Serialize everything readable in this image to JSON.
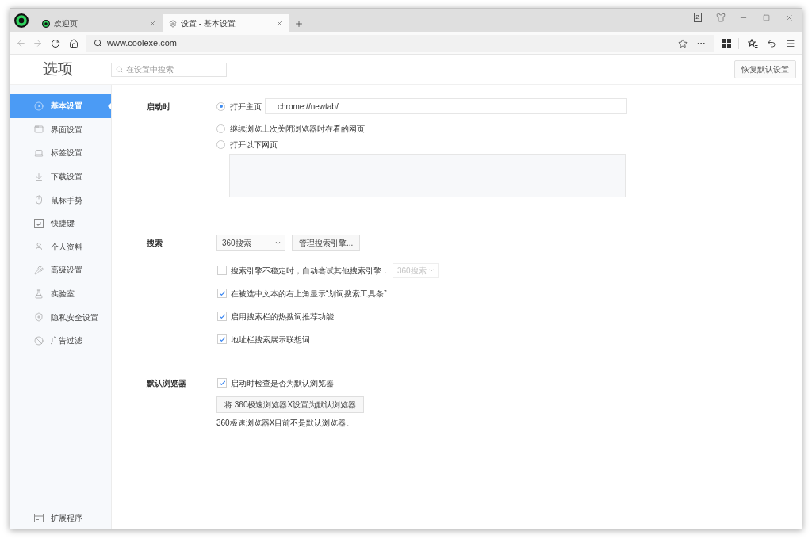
{
  "browser": {
    "tabs": [
      {
        "title": "欢迎页",
        "selected": false
      },
      {
        "title": "设置 - 基本设置",
        "selected": true
      }
    ],
    "tab_count": "2",
    "back": {
      "disabled": true
    },
    "forward": {
      "disabled": true
    },
    "address": "www.coolexe.com"
  },
  "header": {
    "title": "选项",
    "search": {
      "placeholder": "在设置中搜索"
    },
    "reset_button": "恢复默认设置"
  },
  "sidebar": {
    "items": [
      {
        "label": "基本设置",
        "selected": true
      },
      {
        "label": "界面设置",
        "selected": false
      },
      {
        "label": "标签设置",
        "selected": false
      },
      {
        "label": "下载设置",
        "selected": false
      },
      {
        "label": "鼠标手势",
        "selected": false
      },
      {
        "label": "快捷键",
        "selected": false
      },
      {
        "label": "个人资料",
        "selected": false
      },
      {
        "label": "高级设置",
        "selected": false
      },
      {
        "label": "实验室",
        "selected": false
      },
      {
        "label": "隐私安全设置",
        "selected": false
      },
      {
        "label": "广告过滤",
        "selected": false
      }
    ],
    "footer_item": "扩展程序"
  },
  "sections": [
    {
      "label": "启动时",
      "rows": [
        {
          "kind": "radio",
          "label": "打开主页",
          "selected": true,
          "field": {
            "value": "chrome://newtab/"
          }
        },
        {
          "kind": "radio",
          "label": "继续浏览上次关闭浏览器时在看的网页",
          "selected": false
        },
        {
          "kind": "radio_with_list",
          "label": "打开以下网页",
          "selected": false
        }
      ]
    },
    {
      "label": "搜索",
      "rows": [
        {
          "kind": "select",
          "value": "360搜索",
          "button": "管理搜索引擎..."
        },
        {
          "kind": "checkbox",
          "label": "搜索引擎不稳定时，自动尝试其他搜索引擎：",
          "checked": false,
          "select": {
            "value": "360搜索",
            "disabled": true
          }
        },
        {
          "kind": "checkbox",
          "label": "在被选中文本的右上角显示“划词搜索工具条”",
          "checked": true
        },
        {
          "kind": "checkbox",
          "label": "启用搜索栏的热搜词推荐功能",
          "checked": true
        },
        {
          "kind": "checkbox",
          "label": "地址栏搜索展示联想词",
          "checked": true
        }
      ]
    },
    {
      "label": "默认浏览器",
      "rows": [
        {
          "kind": "checkbox",
          "label": "启动时检查是否为默认浏览器",
          "checked": true
        },
        {
          "kind": "button",
          "label": "将 360极速浏览器X设置为默认浏览器"
        },
        {
          "kind": "note",
          "text": "360极速浏览器X目前不是默认浏览器。"
        }
      ]
    }
  ]
}
